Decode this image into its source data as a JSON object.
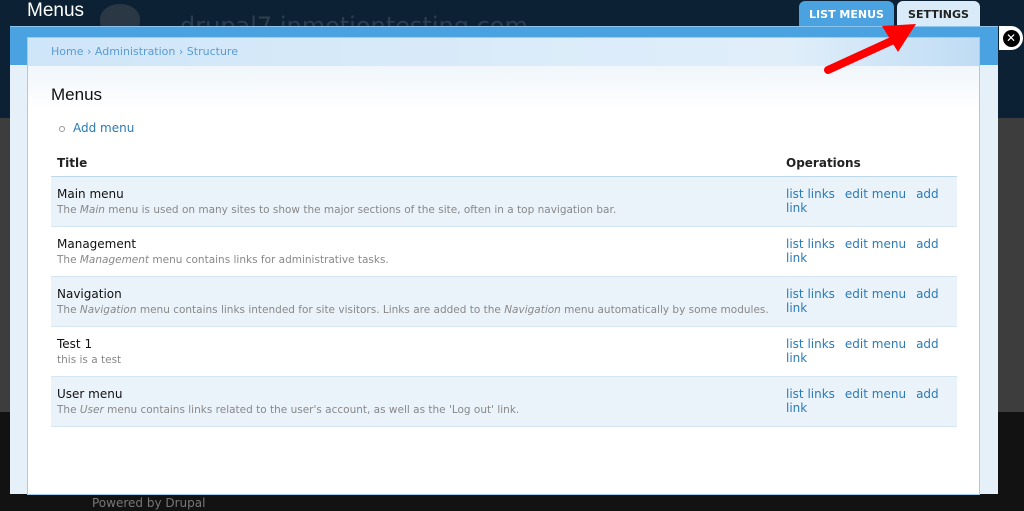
{
  "background": {
    "title": "Menus",
    "site_name": "drupal7.inmotiontesting.com",
    "footer": "Powered by Drupal"
  },
  "tabs": [
    {
      "label": "LIST MENUS"
    },
    {
      "label": "SETTINGS"
    }
  ],
  "breadcrumb": [
    "Home",
    "Administration",
    "Structure"
  ],
  "page_title": "Menus",
  "add_menu": "Add menu",
  "table": {
    "headers": [
      "Title",
      "Operations"
    ],
    "rows": [
      {
        "name": "Main menu",
        "desc_pre": "The ",
        "desc_em": "Main",
        "desc_post": " menu is used on many sites to show the major sections of the site, often in a top navigation bar."
      },
      {
        "name": "Management",
        "desc_pre": "The ",
        "desc_em": "Management",
        "desc_post": " menu contains links for administrative tasks."
      },
      {
        "name": "Navigation",
        "desc_pre": "The ",
        "desc_em": "Navigation",
        "desc_post": " menu contains links intended for site visitors. Links are added to the ",
        "desc_em2": "Navigation",
        "desc_post2": " menu automatically by some modules."
      },
      {
        "name": "Test 1",
        "desc_pre": "this is a test"
      },
      {
        "name": "User menu",
        "desc_pre": "The ",
        "desc_em": "User",
        "desc_post": " menu contains links related to the user's account, as well as the 'Log out' link."
      }
    ],
    "ops": [
      "list links",
      "edit menu",
      "add link"
    ]
  },
  "colors": {
    "accent": "#4aa2e0",
    "link": "#2a7ab8",
    "annotation_arrow": "#ff0000"
  }
}
